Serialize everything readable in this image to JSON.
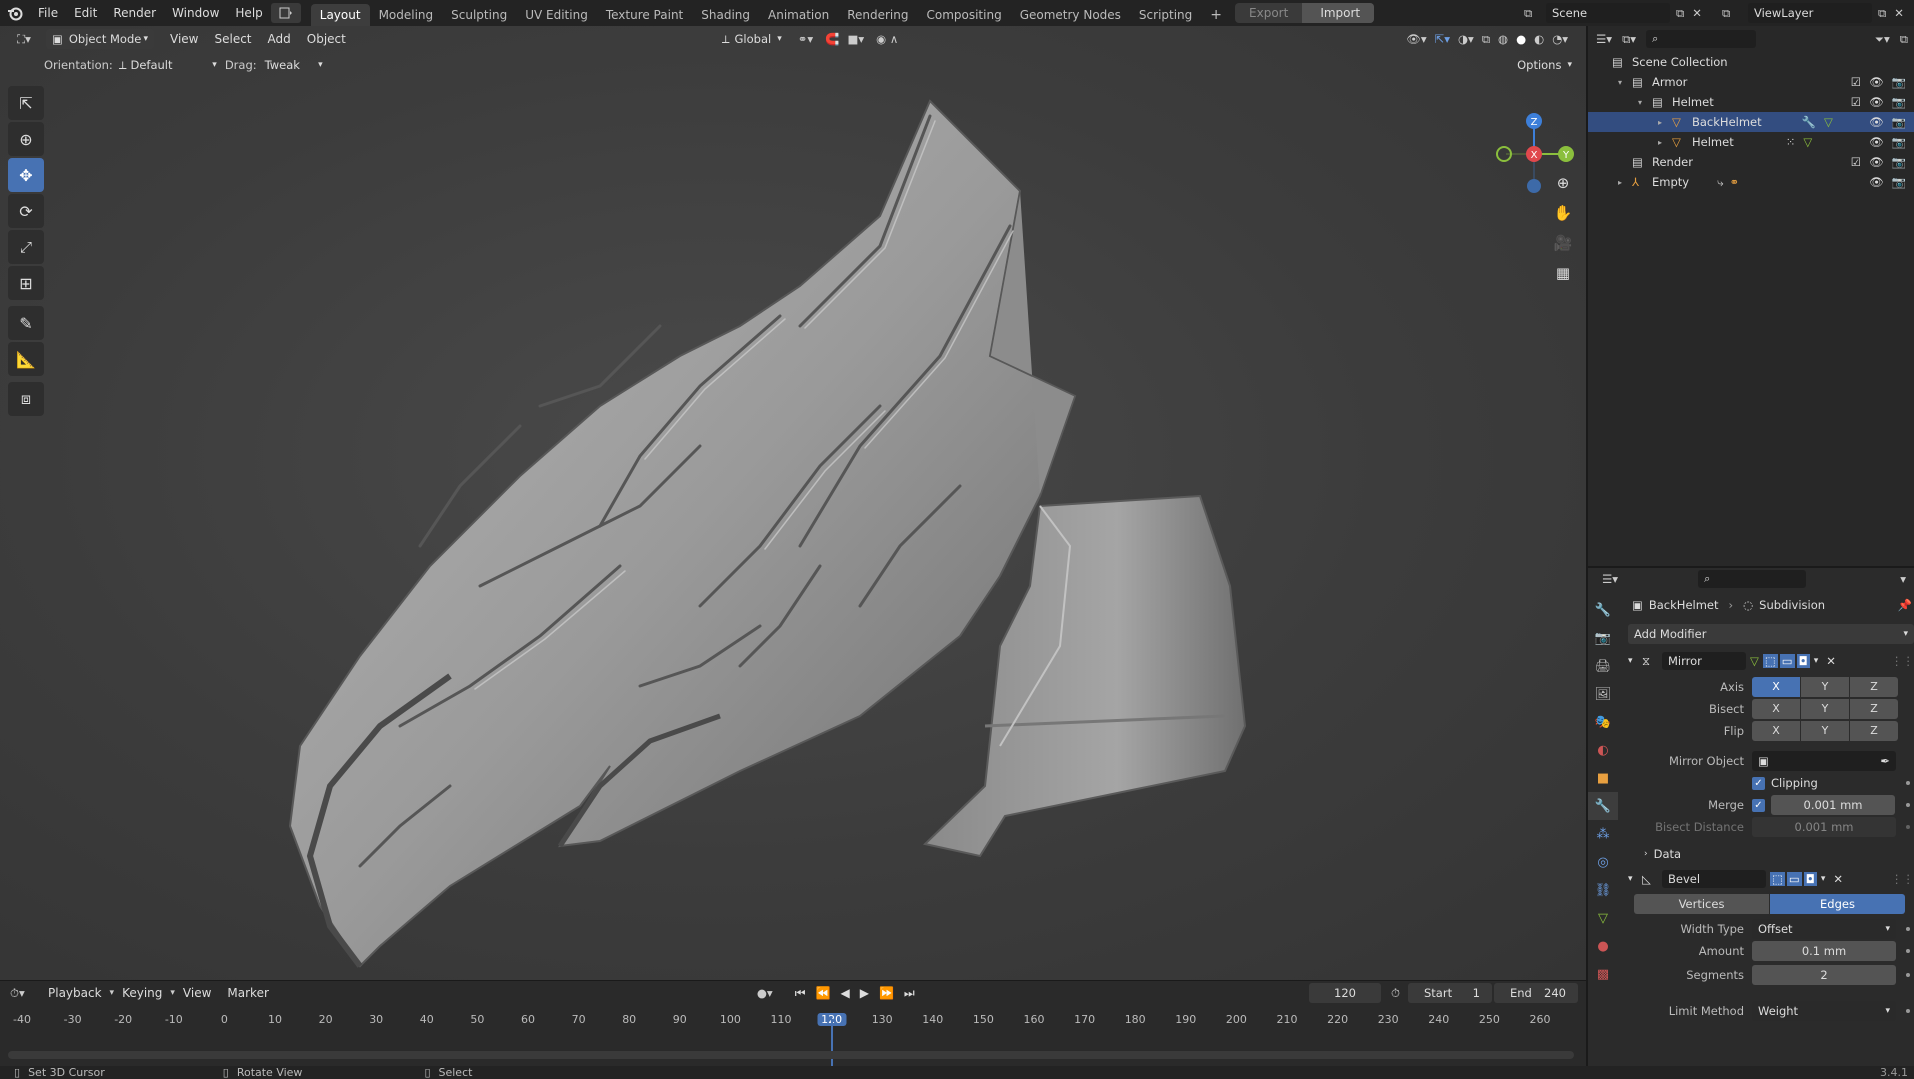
{
  "app": {
    "version": "3.4.1"
  },
  "menubar": {
    "items": [
      "File",
      "Edit",
      "Render",
      "Window",
      "Help"
    ],
    "workspaces": [
      "Layout",
      "Modeling",
      "Sculpting",
      "UV Editing",
      "Texture Paint",
      "Shading",
      "Animation",
      "Rendering",
      "Compositing",
      "Geometry Nodes",
      "Scripting"
    ],
    "active_workspace": "Layout",
    "export_label": "Export",
    "import_label": "Import",
    "scene": "Scene",
    "view_layer": "ViewLayer"
  },
  "viewport": {
    "mode": "Object Mode",
    "menus": [
      "View",
      "Select",
      "Add",
      "Object"
    ],
    "transform_orientation": "Global",
    "orientation_label": "Orientation:",
    "orientation_value": "Default",
    "drag_label": "Drag:",
    "drag_value": "Tweak",
    "options_label": "Options",
    "gizmo": {
      "x": "X",
      "y": "Y",
      "z": "Z"
    },
    "tools": [
      "tweak-icon",
      "cursor-icon",
      "move-icon",
      "rotate-icon",
      "scale-icon",
      "transform-icon",
      "annotate-icon",
      "measure-icon",
      "add-cube-icon"
    ],
    "active_tool": "move-icon"
  },
  "outliner": {
    "search_placeholder": "",
    "items": [
      {
        "label": "Scene Collection",
        "depth": 0,
        "icon": "collection-icon"
      },
      {
        "label": "Armor",
        "depth": 1,
        "icon": "collection-icon"
      },
      {
        "label": "Helmet",
        "depth": 2,
        "icon": "collection-icon"
      },
      {
        "label": "BackHelmet",
        "depth": 3,
        "icon": "mesh-icon",
        "selected": true
      },
      {
        "label": "Helmet",
        "depth": 3,
        "icon": "mesh-icon"
      },
      {
        "label": "Render",
        "depth": 1,
        "icon": "collection-icon"
      },
      {
        "label": "Empty",
        "depth": 1,
        "icon": "empty-icon"
      }
    ]
  },
  "properties": {
    "breadcrumb_object": "BackHelmet",
    "breadcrumb_modifier": "Subdivision",
    "add_modifier_label": "Add Modifier",
    "mirror": {
      "name": "Mirror",
      "axis_label": "Axis",
      "bisect_label": "Bisect",
      "flip_label": "Flip",
      "axes": [
        "X",
        "Y",
        "Z"
      ],
      "mirror_object_label": "Mirror Object",
      "clipping_label": "Clipping",
      "merge_label": "Merge",
      "merge_value": "0.001 mm",
      "bisect_distance_label": "Bisect Distance",
      "bisect_distance_value": "0.001 mm",
      "data_label": "Data"
    },
    "bevel": {
      "name": "Bevel",
      "tab_vertices": "Vertices",
      "tab_edges": "Edges",
      "width_type_label": "Width Type",
      "width_type_value": "Offset",
      "amount_label": "Amount",
      "amount_value": "0.1 mm",
      "segments_label": "Segments",
      "segments_value": "2",
      "limit_method_label": "Limit Method",
      "limit_method_value": "Weight"
    }
  },
  "timeline": {
    "menus": [
      "Playback",
      "Keying",
      "View",
      "Marker"
    ],
    "current_frame": "120",
    "start_label": "Start",
    "start_value": "1",
    "end_label": "End",
    "end_value": "240",
    "ticks": [
      "-40",
      "-30",
      "-20",
      "-10",
      "0",
      "10",
      "20",
      "30",
      "40",
      "50",
      "60",
      "70",
      "80",
      "90",
      "100",
      "110",
      "120",
      "130",
      "140",
      "150",
      "160",
      "170",
      "180",
      "190",
      "200",
      "210",
      "220",
      "230",
      "240",
      "250",
      "260"
    ]
  },
  "statusbar": {
    "left": "Set 3D Cursor",
    "middle": "Rotate View",
    "right": "Select"
  },
  "colors": {
    "accent": "#4772b3",
    "x_axis": "#e0484d",
    "y_axis": "#8bbf3d",
    "z_axis": "#3d7fd9"
  }
}
